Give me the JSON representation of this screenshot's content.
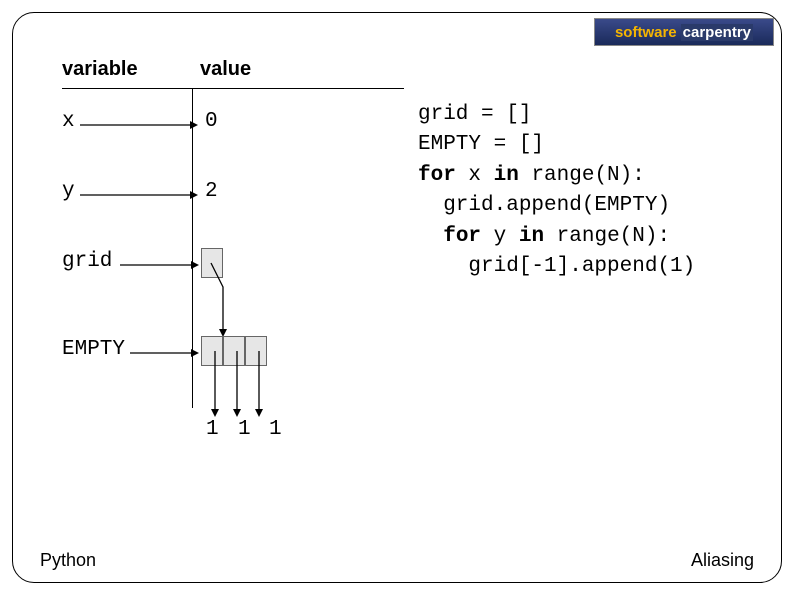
{
  "logo": {
    "word1": "software",
    "word2": "carpentry"
  },
  "table": {
    "head_variable": "variable",
    "head_value": "value",
    "rows": {
      "x": {
        "label": "x",
        "value": "0"
      },
      "y": {
        "label": "y",
        "value": "2"
      },
      "grid": {
        "label": "grid"
      },
      "empty": {
        "label": "EMPTY"
      }
    }
  },
  "element_values": {
    "n0": "1",
    "n1": "1",
    "n2": "1"
  },
  "code": {
    "l1a": "grid = []",
    "l2a": "EMPTY = []",
    "l3a": "for",
    "l3b": " x ",
    "l3c": "in",
    "l3d": " range(N):",
    "l4a": "  grid.append(EMPTY)",
    "l5a": "  ",
    "l5b": "for",
    "l5c": " y ",
    "l5d": "in",
    "l5e": " range(N):",
    "l6a": "    grid[-1].append(1)"
  },
  "footer": {
    "left": "Python",
    "right": "Aliasing"
  }
}
